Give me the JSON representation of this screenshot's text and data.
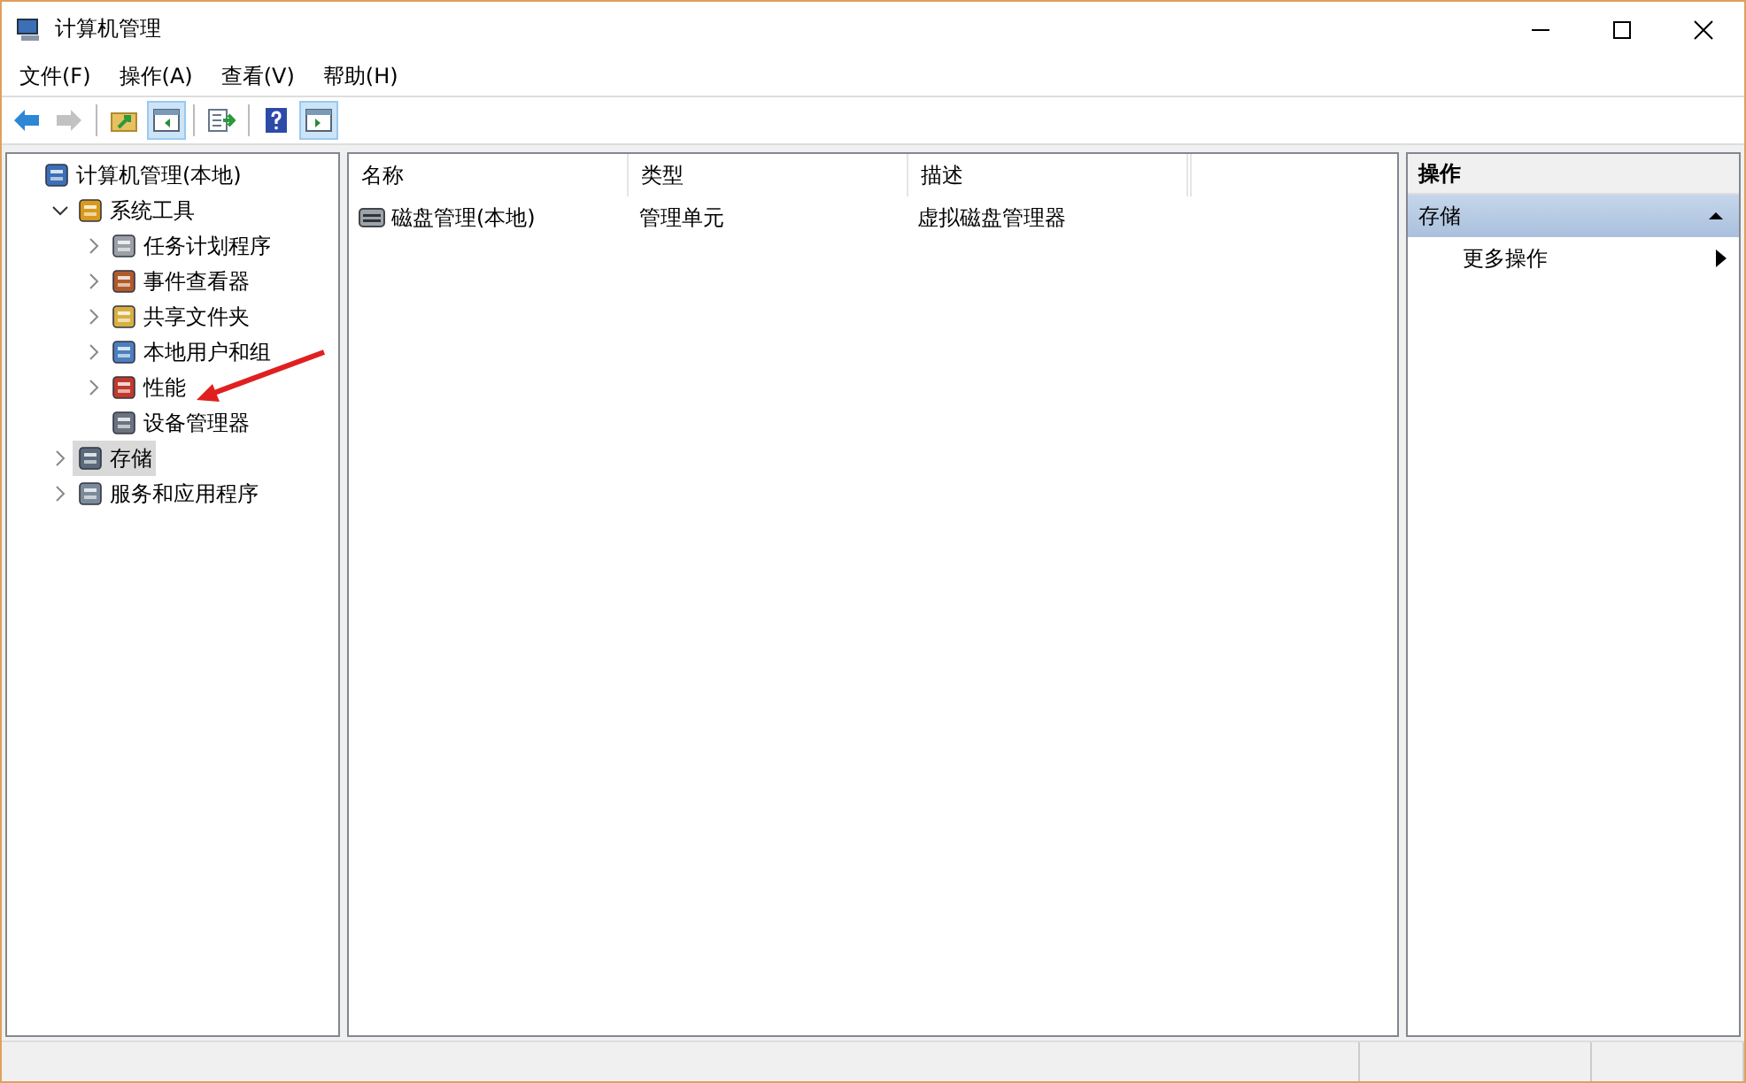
{
  "window": {
    "title": "计算机管理"
  },
  "menu": [
    "文件(F)",
    "操作(A)",
    "查看(V)",
    "帮助(H)"
  ],
  "toolbar": [
    {
      "kind": "back",
      "disabled": false,
      "pressed": false
    },
    {
      "kind": "forward",
      "disabled": true,
      "pressed": false
    },
    {
      "kind": "separator"
    },
    {
      "kind": "up",
      "disabled": false,
      "pressed": false
    },
    {
      "kind": "tree",
      "disabled": false,
      "pressed": true
    },
    {
      "kind": "separator"
    },
    {
      "kind": "export",
      "disabled": false,
      "pressed": false
    },
    {
      "kind": "separator"
    },
    {
      "kind": "help",
      "disabled": false,
      "pressed": false
    },
    {
      "kind": "actions",
      "disabled": false,
      "pressed": true
    }
  ],
  "tree": [
    {
      "label": "计算机管理(本地)",
      "selected": false,
      "children": [
        {
          "label": "系统工具",
          "selected": false,
          "expanded": true,
          "children": [
            {
              "label": "任务计划程序",
              "selected": false,
              "expanded": false
            },
            {
              "label": "事件查看器",
              "selected": false,
              "expanded": false
            },
            {
              "label": "共享文件夹",
              "selected": false,
              "expanded": false
            },
            {
              "label": "本地用户和组",
              "selected": false,
              "expanded": false
            },
            {
              "label": "性能",
              "selected": false,
              "expanded": false
            },
            {
              "label": "设备管理器",
              "selected": false
            }
          ]
        },
        {
          "label": "存储",
          "selected": true,
          "expanded": false
        },
        {
          "label": "服务和应用程序",
          "selected": false,
          "expanded": false
        }
      ]
    }
  ],
  "table": {
    "columns": [
      "名称",
      "类型",
      "描述"
    ],
    "rows": [
      {
        "name": "磁盘管理(本地)",
        "type": "管理单元",
        "description": "虚拟磁盘管理器"
      }
    ]
  },
  "actions": {
    "title": "操作",
    "sections": [
      {
        "title": "存储",
        "expanded": true,
        "items": [
          {
            "label": "更多操作",
            "submenu": true
          }
        ]
      }
    ]
  }
}
